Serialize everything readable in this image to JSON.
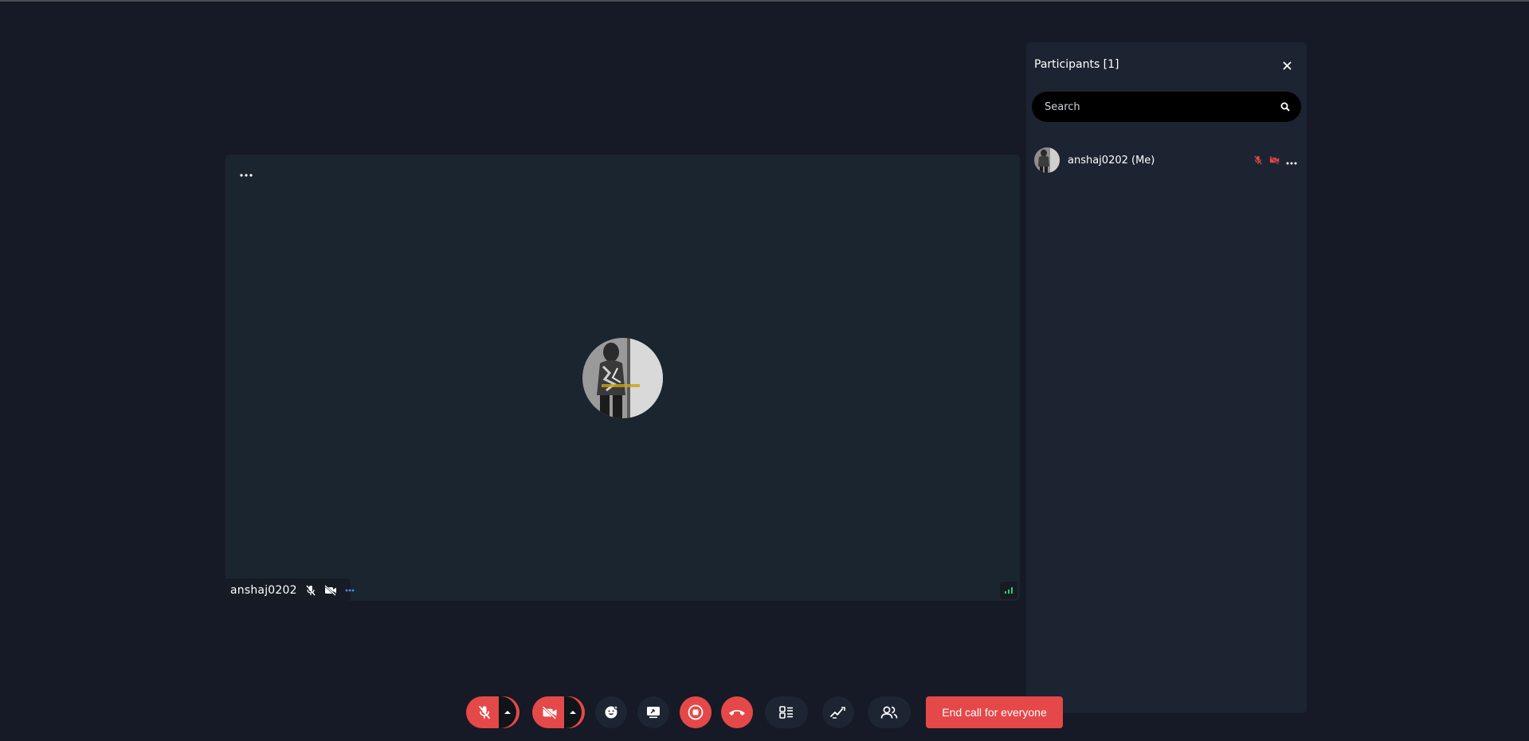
{
  "tile": {
    "participant_name": "anshaj0202"
  },
  "panel": {
    "title": "Participants [1]",
    "search_placeholder": "Search",
    "participants": [
      {
        "name": "anshaj0202 (Me)"
      }
    ]
  },
  "toolbar": {
    "end_call_label": "End call for everyone"
  },
  "colors": {
    "background": "#161a26",
    "tile": "#1b252f",
    "panel": "#1c2432",
    "danger": "#e54848",
    "signal": "#2ecc71"
  }
}
